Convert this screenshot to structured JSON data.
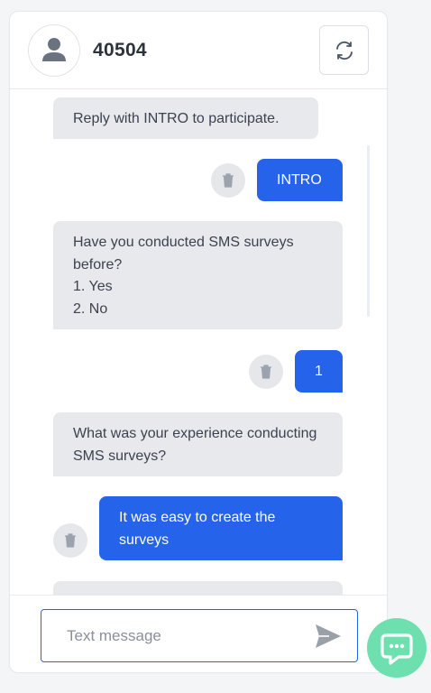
{
  "header": {
    "contact_name": "40504",
    "avatar_icon": "user-icon",
    "refresh_icon": "refresh-icon"
  },
  "messages": [
    {
      "direction": "incoming",
      "text": "Reply with INTRO to participate."
    },
    {
      "direction": "outgoing",
      "text": "INTRO"
    },
    {
      "direction": "incoming",
      "text": "Have you conducted SMS surveys before?\n1. Yes\n2. No"
    },
    {
      "direction": "outgoing",
      "text": "1"
    },
    {
      "direction": "incoming",
      "text": "What was your experience conducting SMS surveys?"
    },
    {
      "direction": "outgoing",
      "text": "It was easy to create the surveys"
    }
  ],
  "composer": {
    "placeholder": "Text message",
    "value": "",
    "send_icon": "send-icon"
  },
  "chat_widget": {
    "icon": "chat-bubble-icon"
  },
  "colors": {
    "outgoing_bubble": "#2563eb",
    "incoming_bubble": "#e8e9ec",
    "chat_fab": "#6ee0b0"
  }
}
